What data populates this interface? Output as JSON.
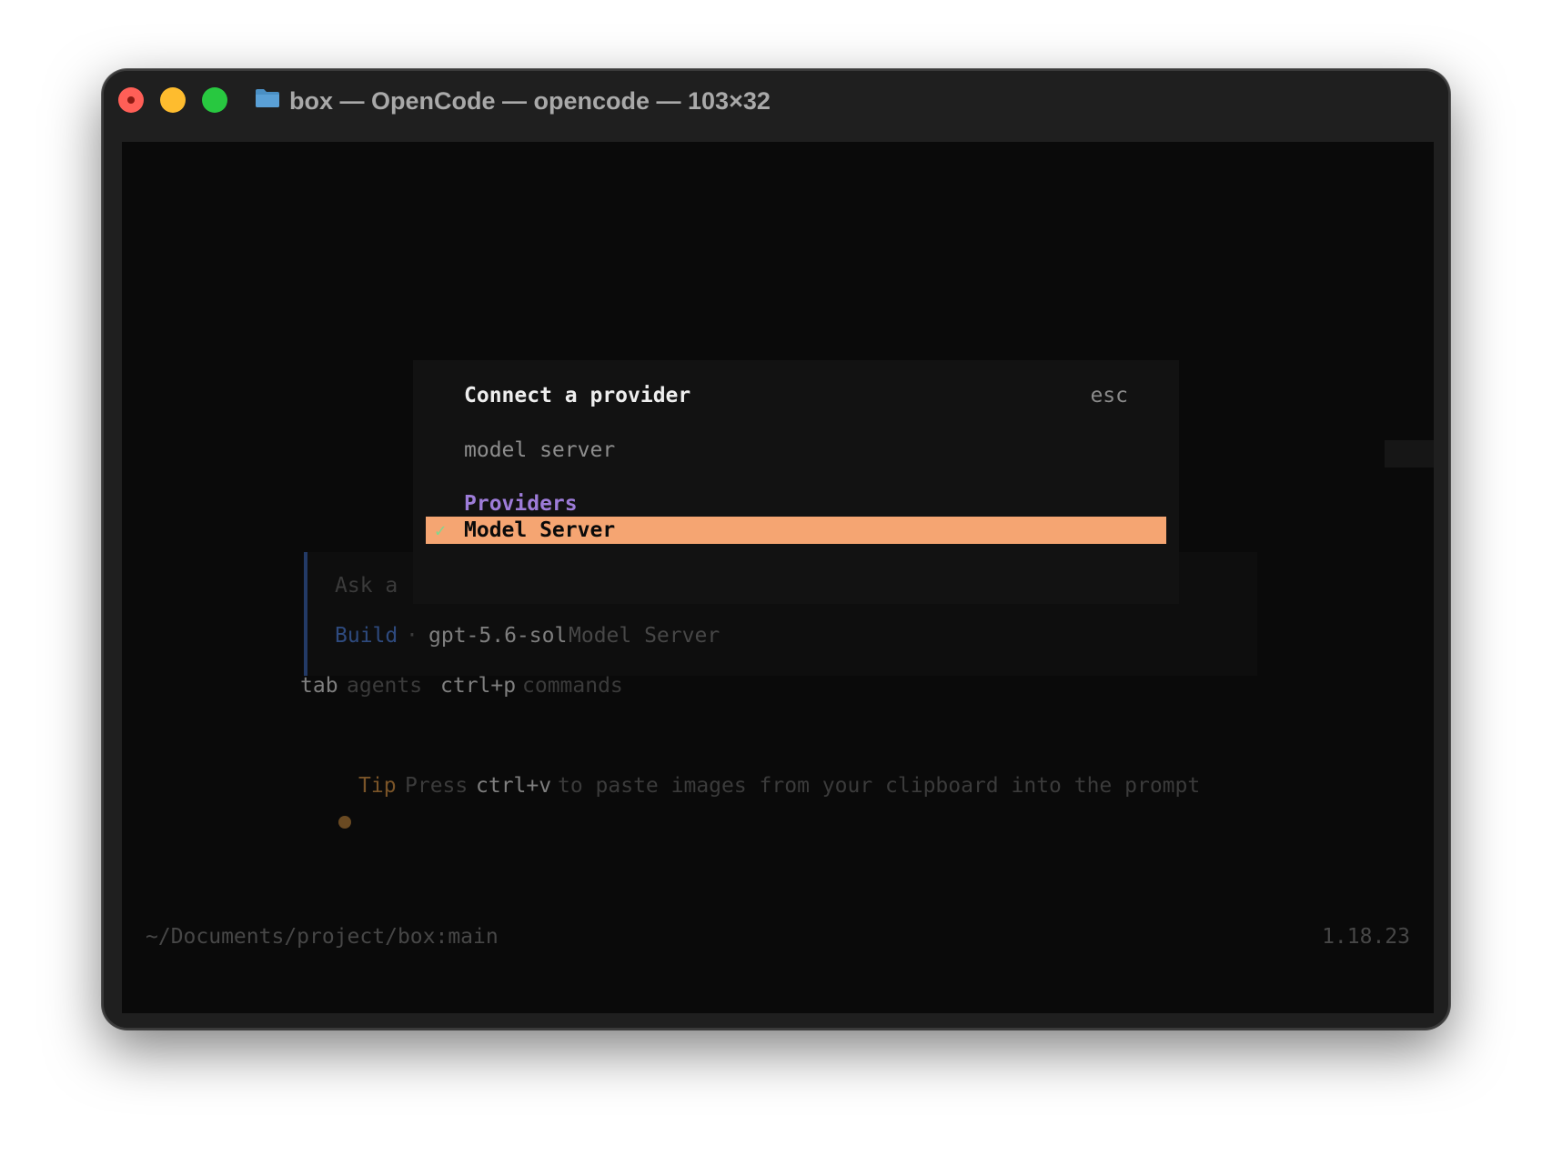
{
  "window": {
    "title": "box — OpenCode — opencode — 103×32"
  },
  "prompt": {
    "placeholder_fragment": "Ask a",
    "agent": "Build",
    "separator": "·",
    "model": "gpt-5.6-sol",
    "provider": "Model Server"
  },
  "hints": {
    "tab_key": "tab",
    "tab_label": "agents",
    "commands_key": "ctrl+p",
    "commands_label": "commands"
  },
  "tip": {
    "label": "Tip",
    "text_before": "Press",
    "key": "ctrl+v",
    "text_after": "to paste images from your clipboard into the prompt"
  },
  "status": {
    "path": "~/Documents/project/box:main",
    "version": "1.18.23"
  },
  "modal": {
    "title": "Connect a provider",
    "esc": "esc",
    "search_value": "model server",
    "section": "Providers",
    "items": [
      {
        "label": "Model Server",
        "check": "✓",
        "selected": true
      }
    ]
  },
  "colors": {
    "accent_selection": "#f5a572",
    "section_purple": "#9d7cd8",
    "agent_blue": "#2e4a7e",
    "tip_orange": "#7a5428",
    "check_green": "#7fd88f"
  }
}
